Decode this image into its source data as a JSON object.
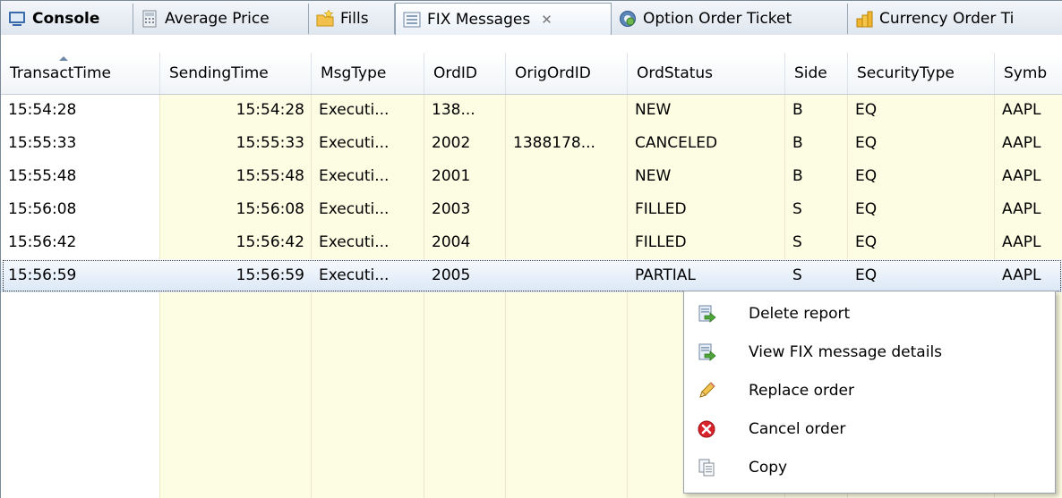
{
  "tabs": [
    {
      "label": "Console",
      "icon": "console-icon",
      "active": false,
      "bold": true
    },
    {
      "label": "Average Price",
      "icon": "calculator-icon",
      "active": false
    },
    {
      "label": "Fills",
      "icon": "star-folder-icon",
      "active": false
    },
    {
      "label": "FIX Messages",
      "icon": "list-icon",
      "active": true,
      "close": "✕"
    },
    {
      "label": "Option Order Ticket",
      "icon": "gear-globe-icon",
      "active": false
    },
    {
      "label": "Currency Order Ti",
      "icon": "coins-icon",
      "active": false
    }
  ],
  "columns": [
    "TransactTime",
    "SendingTime",
    "MsgType",
    "OrdID",
    "OrigOrdID",
    "OrdStatus",
    "Side",
    "SecurityType",
    "Symb"
  ],
  "rows": [
    [
      "15:54:28",
      "15:54:28",
      "Executi...",
      "138...",
      "",
      "NEW",
      "B",
      "EQ",
      "AAPL"
    ],
    [
      "15:55:33",
      "15:55:33",
      "Executi...",
      "2002",
      "1388178...",
      "CANCELED",
      "B",
      "EQ",
      "AAPL"
    ],
    [
      "15:55:48",
      "15:55:48",
      "Executi...",
      "2001",
      "",
      "NEW",
      "B",
      "EQ",
      "AAPL"
    ],
    [
      "15:56:08",
      "15:56:08",
      "Executi...",
      "2003",
      "",
      "FILLED",
      "S",
      "EQ",
      "AAPL"
    ],
    [
      "15:56:42",
      "15:56:42",
      "Executi...",
      "2004",
      "",
      "FILLED",
      "S",
      "EQ",
      "AAPL"
    ],
    [
      "15:56:59",
      "15:56:59",
      "Executi...",
      "2005",
      "",
      "PARTIAL",
      "S",
      "EQ",
      "AAPL"
    ]
  ],
  "selected_row": 5,
  "context_menu": [
    {
      "label": "Delete report",
      "icon": "report-arrow-icon"
    },
    {
      "label": "View FIX message details",
      "icon": "report-arrow-icon"
    },
    {
      "label": "Replace order",
      "icon": "pencil-icon"
    },
    {
      "label": "Cancel order",
      "icon": "cancel-icon"
    },
    {
      "label": "Copy",
      "icon": "copy-icon"
    }
  ],
  "colors": {
    "column_tint": "#fdfde4",
    "selection": "#dbe8f6",
    "cancel_red": "#d8232a"
  }
}
